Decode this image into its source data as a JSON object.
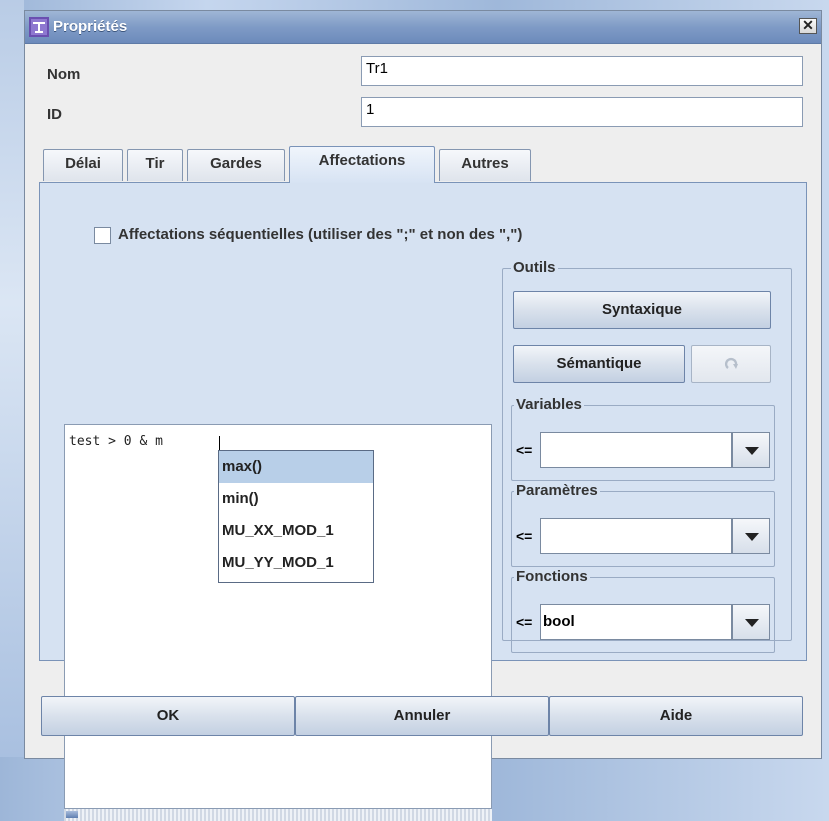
{
  "window": {
    "title": "Propriétés",
    "close_glyph": "✕"
  },
  "form": {
    "nom_label": "Nom",
    "nom_value": "Tr1",
    "id_label": "ID",
    "id_value": "1"
  },
  "tabs": [
    {
      "label": "Délai"
    },
    {
      "label": "Tir"
    },
    {
      "label": "Gardes"
    },
    {
      "label": "Affectations",
      "active": true
    },
    {
      "label": "Autres"
    }
  ],
  "affectations": {
    "sequential_label": "Affectations séquentielles (utiliser des \";\" et non des \",\")",
    "sequential_checked": false,
    "editor_text": "test > 0 & m",
    "autocomplete": [
      "max()",
      "min()",
      "MU_XX_MOD_1",
      "MU_YY_MOD_1"
    ],
    "autocomplete_selected": 0
  },
  "tools": {
    "title": "Outils",
    "syntax_label": "Syntaxique",
    "semantic_label": "Sémantique",
    "refresh_icon": "redo-icon",
    "variables": {
      "title": "Variables",
      "prefix": "<=",
      "value": ""
    },
    "parametres": {
      "title": "Paramètres",
      "prefix": "<=",
      "value": ""
    },
    "fonctions": {
      "title": "Fonctions",
      "prefix": "<=",
      "value": "bool"
    }
  },
  "footer": {
    "ok": "OK",
    "cancel": "Annuler",
    "help": "Aide"
  },
  "colors": {
    "titlebar": "#7f9bc6",
    "panel": "#d6e2f2",
    "popup_selection": "#b8cfe8"
  }
}
